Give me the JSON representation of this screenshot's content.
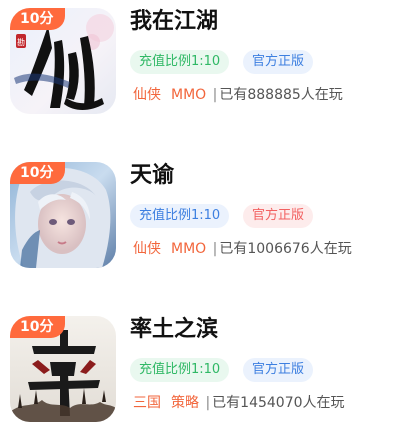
{
  "colors": {
    "badge": "#ff6a3d",
    "genre": "#f2663c",
    "tag_green": "#2fb865",
    "tag_blue": "#3d7fe0",
    "tag_pink": "#f26161"
  },
  "games": [
    {
      "title": "我在江湖",
      "badge": "10分",
      "icon": "xian-calligraphy-game-icon",
      "icon_seal_text": "勘",
      "tags": [
        {
          "label": "充值比例1:10",
          "color": "green"
        },
        {
          "label": "官方正版",
          "color": "blue"
        }
      ],
      "genres": [
        "仙侠",
        "MMO"
      ],
      "separator": "|",
      "players": "已有888885人在玩"
    },
    {
      "title": "天谕",
      "badge": "10分",
      "icon": "fairy-character-game-icon",
      "tags": [
        {
          "label": "充值比例1:10",
          "color": "blue"
        },
        {
          "label": "官方正版",
          "color": "pink"
        }
      ],
      "genres": [
        "仙侠",
        "MMO"
      ],
      "separator": "|",
      "players": "已有1006676人在玩"
    },
    {
      "title": "率土之滨",
      "badge": "10分",
      "icon": "lu-calligraphy-game-icon",
      "tags": [
        {
          "label": "充值比例1:10",
          "color": "green"
        },
        {
          "label": "官方正版",
          "color": "blue"
        }
      ],
      "genres": [
        "三国",
        "策略"
      ],
      "separator": "|",
      "players": "已有1454070人在玩"
    }
  ]
}
